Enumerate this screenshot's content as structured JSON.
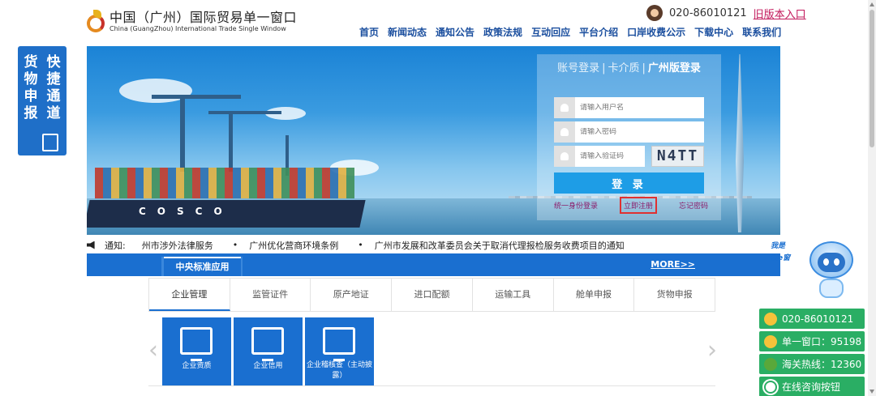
{
  "header": {
    "logo_cn": "中国（广州）国际贸易单一窗口",
    "logo_en": "China (GuangZhou) International Trade Single Window",
    "hotline": "020-86010121",
    "old_version_link": "旧版本入口",
    "nav": [
      "首页",
      "新闻动态",
      "通知公告",
      "政策法规",
      "互动回应",
      "平台介绍",
      "口岸收费公示",
      "下载中心",
      "联系我们"
    ]
  },
  "float_left": {
    "col1": [
      "货",
      "物",
      "申",
      "报"
    ],
    "col2": [
      "快",
      "捷",
      "通",
      "道"
    ]
  },
  "banner": {
    "ship_name": "COSCO"
  },
  "login": {
    "tabs": [
      "账号登录",
      "卡介质",
      "广州版登录"
    ],
    "active_tab": "广州版登录",
    "username_placeholder": "请输入用户名",
    "password_placeholder": "请输入密码",
    "captcha_placeholder": "请输入验证码",
    "captcha_value": "N4TT",
    "login_button": "登 录",
    "link_unified": "统一身份登录",
    "link_register": "立即注册",
    "link_forgot": "忘记密码"
  },
  "notice": {
    "label": "通知:",
    "items": [
      "州市涉外法律服务",
      "广州优化营商环境条例",
      "广州市发展和改革委员会关于取消代理报检服务收费项目的通知"
    ]
  },
  "apps": {
    "tab": "中央标准应用",
    "more": "MORE>>",
    "categories": [
      "企业管理",
      "监管证件",
      "原产地证",
      "进口配额",
      "运输工具",
      "舱单申报",
      "货物申报"
    ],
    "active_category": "企业管理",
    "tiles": [
      "企业资质",
      "企业信用",
      "企业稽核查（主动披露）"
    ]
  },
  "assistant": {
    "label_line1": "我是",
    "label_line2": "穗e窗"
  },
  "contacts": [
    {
      "label": "020-86010121",
      "icon": "logo-icon"
    },
    {
      "label": "单一窗口：95198",
      "icon": "logo-icon"
    },
    {
      "label": "海关热线：12360",
      "icon": "phone-icon"
    },
    {
      "label": "在线咨询按钮",
      "icon": "chat-icon"
    }
  ]
}
